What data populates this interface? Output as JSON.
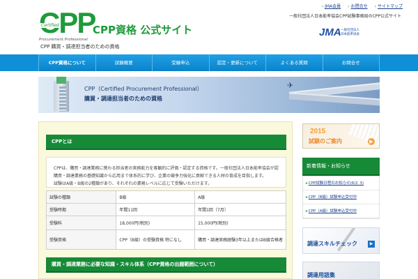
{
  "header": {
    "logo_text": "CPP",
    "logo_cert": "Certified",
    "logo_sub": "Procurement Professional",
    "site_title": "CPP資格 公式サイト",
    "tagline": "CPP 購買・調達担当者のための資格",
    "top_links": [
      "JMA会員",
      "お問合せ",
      "サイトマップ"
    ],
    "note": "一般社団法人日本能率協会CPP試験事務局のCPP公式サイト",
    "jma_mark": "JMA",
    "jma_text_1": "一般社団法人",
    "jma_text_2": "日本能率協会"
  },
  "nav": {
    "items": [
      "CPP資格について",
      "試験概要",
      "受験申込",
      "認定・更新について",
      "よくある質問",
      "お問合せ"
    ]
  },
  "banner": {
    "title_en": "CPP（Certified Procurement Professional）",
    "title_jp": "購買・調達担当者のための資格"
  },
  "main": {
    "section1_title": "CPPとは",
    "intro_lines": [
      "CPPは、購買・調達業務に携わる担当者の実務能力を客観的に評価・認定する資格です。一般社団法人日本能率協会が認定します。",
      "購買・調達業務の基礎知識から応用まで体系的に学び、企業の競争力強化に貢献できる人材の育成を目指します。",
      "試験はA級・B級の2種類があり、それぞれの業務レベルに応じて受験いただけます。"
    ],
    "table": {
      "rows": [
        [
          "試験の種類",
          "B級",
          "A級"
        ],
        [
          "受験時期",
          "年間11回",
          "年間1回（7月）"
        ],
        [
          "受験料",
          "18,000円(税別)",
          "15,000円(税別)"
        ],
        [
          "受験資格",
          "CPP（B級）の受験資格 特になし",
          "購買・調達実務経験3年以上またはB級合格者"
        ]
      ]
    },
    "section2_title": "購買・調達業務に必要な知識・スキル体系（CPP資格の出題範囲について）"
  },
  "sidebar": {
    "promo_year": "2015",
    "promo_text": "試験のご案内",
    "promo_arrow": "▶",
    "news_title": "新着情報・お知らせ",
    "news_items": [
      "CPP試験日程のお知らせ(6/2_3)",
      "CPP（B級）試験申込受付中",
      "CPP（A級）試験申込受付中"
    ],
    "skill_text": "調達スキルチェック",
    "skill_arrow": "▶",
    "glossary_text": "調達用語集"
  },
  "colors": {
    "brand_green": "#1f9a3b",
    "nav_blue": "#0e8fd7",
    "section_green": "#178a38",
    "content_bg": "#fbf9dd",
    "link_blue": "#1a3e8c"
  }
}
